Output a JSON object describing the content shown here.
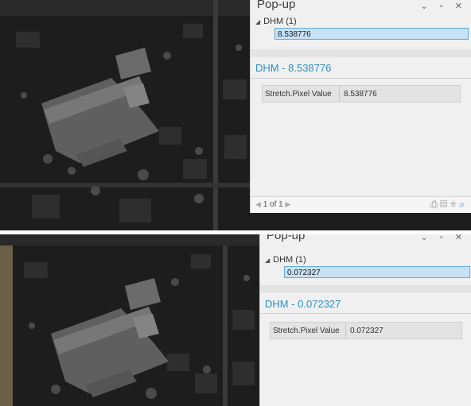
{
  "popups": [
    {
      "title": "Pop-up",
      "window_buttons": "⌄ ▫ ✕",
      "layer_node": "DHM (1)",
      "selected_value": "8.538776",
      "feature_title": "DHM - 8.538776",
      "attribute": {
        "field": "Stretch.Pixel Value",
        "value": "8.538776"
      },
      "pager": "1 of 1"
    },
    {
      "title": "Pop-up",
      "window_buttons": "⌄ ▫ ✕",
      "layer_node": "DHM (1)",
      "selected_value": "0.072327",
      "feature_title": "DHM - 0.072327",
      "attribute": {
        "field": "Stretch.Pixel Value",
        "value": "0.072327"
      }
    }
  ],
  "icons": [
    "collapse-triangle-icon",
    "print-icon",
    "export-icon",
    "flash-icon",
    "zoom-icon"
  ]
}
